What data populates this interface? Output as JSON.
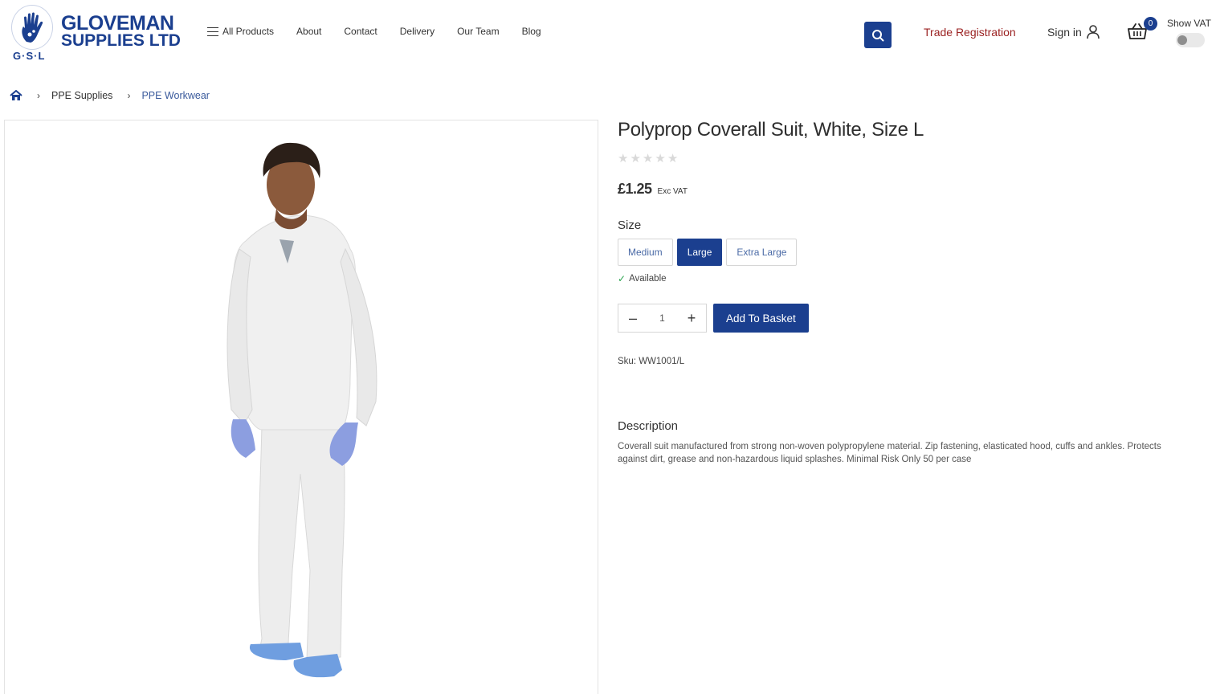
{
  "brand": {
    "line1": "GLOVEMAN",
    "line2": "SUPPLIES LTD",
    "initials": "G·S·L",
    "primary_color": "#1b3f8f",
    "accent_color": "#9b2222"
  },
  "nav": {
    "all_products": "All Products",
    "items": [
      "About",
      "Contact",
      "Delivery",
      "Our Team",
      "Blog"
    ]
  },
  "header": {
    "search_icon": "search-icon",
    "trade_registration": "Trade Registration",
    "sign_in": "Sign in",
    "basket_count": "0",
    "show_vat_label": "Show VAT",
    "show_vat_enabled": false
  },
  "breadcrumb": {
    "home_icon": "home-icon",
    "items": [
      "PPE Supplies",
      "PPE Workwear"
    ]
  },
  "product": {
    "title": "Polyprop Coverall Suit, White, Size L",
    "rating": 0,
    "rating_max": 5,
    "price": "£1.25",
    "price_note": "Exc VAT",
    "size_label": "Size",
    "sizes": [
      "Medium",
      "Large",
      "Extra Large"
    ],
    "selected_size": "Large",
    "availability": "Available",
    "quantity": "1",
    "add_to_basket": "Add To Basket",
    "sku": "Sku: WW1001/L",
    "description_title": "Description",
    "description": "Coverall suit manufactured from strong non-woven polypropylene material. Zip fastening, elasticated hood, cuffs and ankles. Protects against dirt, grease and non-hazardous liquid splashes. Minimal Risk Only 50 per case"
  }
}
